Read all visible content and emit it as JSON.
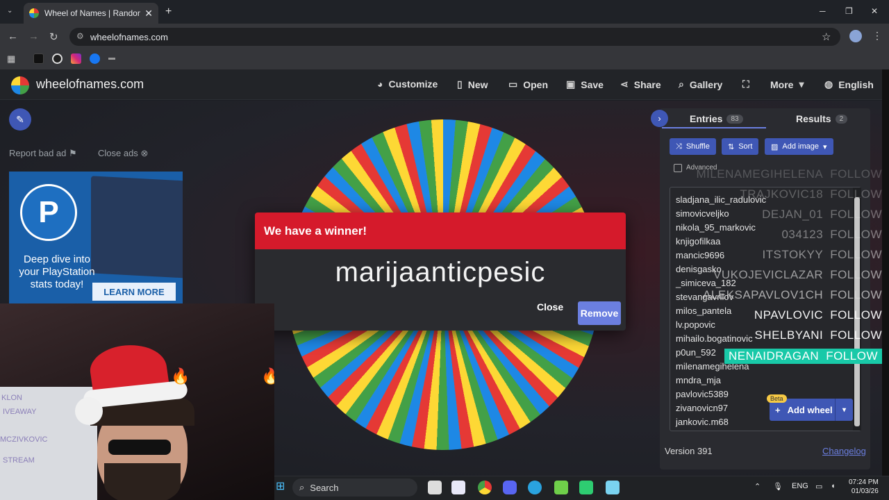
{
  "browser": {
    "tab_title": "Wheel of Names | Random nam",
    "tab_close": "✕",
    "new_tab": "+",
    "url": "wheelofnames.com",
    "window_controls": [
      "─",
      "❐",
      "✕"
    ]
  },
  "header": {
    "site_name": "wheelofnames.com",
    "nav": [
      {
        "label": "Customize",
        "icon": "palette-icon"
      },
      {
        "label": "New",
        "icon": "file-icon"
      },
      {
        "label": "Open",
        "icon": "folder-icon"
      },
      {
        "label": "Save",
        "icon": "save-icon"
      },
      {
        "label": "Share",
        "icon": "share-icon"
      },
      {
        "label": "Gallery",
        "icon": "search-icon"
      },
      {
        "label": "",
        "icon": "fullscreen-icon"
      },
      {
        "label": "More",
        "icon": "chevron-down-icon"
      },
      {
        "label": "English",
        "icon": "globe-icon"
      }
    ]
  },
  "ads": {
    "report_label": "Report bad ad",
    "close_label": "Close ads",
    "ad_text": "Deep dive into your PlayStation stats today!",
    "ad_cta": "LEARN MORE",
    "ad_logo": "P"
  },
  "dialog": {
    "title": "We have a winner!",
    "winner": "marijaanticpesic",
    "close_label": "Close",
    "remove_label": "Remove"
  },
  "panel": {
    "tabs": [
      {
        "label": "Entries",
        "count": "83"
      },
      {
        "label": "Results",
        "count": "2"
      }
    ],
    "tools": {
      "shuffle": "Shuffle",
      "sort": "Sort",
      "add_image": "Add image"
    },
    "advanced_label": "Advanced",
    "entries": [
      "sladjana_ilic_radulovic",
      "simovicveljko",
      "nikola_95_markovic",
      "knjigofilkaa",
      "mancic9696",
      "denisgasko",
      "_simiceva_182",
      "stevangavrilov",
      "milos_pantela",
      "lv.popovic",
      "mihailo.bogatinovic",
      "p0un_592",
      "milenamegihelena",
      "mndra_mja",
      "pavlovic5389",
      "zivanovicn97",
      "jankovic.m68"
    ],
    "add_wheel_label": "Add wheel",
    "beta_label": "Beta",
    "version": "Version 391",
    "changelog": "Changelog"
  },
  "stream_overlay": {
    "follows": [
      {
        "name": "MILENAMEGIHELENA",
        "action": "FOLLOW"
      },
      {
        "name": "TRAJKOVIC18",
        "action": "FOLLOW"
      },
      {
        "name": "DEJAN_01",
        "action": "FOLLOW"
      },
      {
        "name": "034123",
        "action": "FOLLOW"
      },
      {
        "name": "ITSTOKYY",
        "action": "FOLLOW"
      },
      {
        "name": "VUKOJEVICLAZAR",
        "action": "FOLLOW"
      },
      {
        "name": "ALEKSAPAVLOV1CH",
        "action": "FOLLOW"
      },
      {
        "name": "NPAVLOVIC",
        "action": "FOLLOW"
      },
      {
        "name": "SHELBYANI",
        "action": "FOLLOW"
      },
      {
        "name": "NENAIDRAGAN",
        "action": "FOLLOW"
      }
    ]
  },
  "taskbar": {
    "search_label": "Search",
    "lang": "ENG",
    "time": "07:24 PM",
    "date": "01/03/26"
  },
  "colors": {
    "wheel": [
      "#1e88e5",
      "#43a047",
      "#fdd835",
      "#e53935"
    ],
    "dialog_header": "#d51a2b",
    "accent": "#3f57b5",
    "follow_highlight": "#19c9a8"
  }
}
